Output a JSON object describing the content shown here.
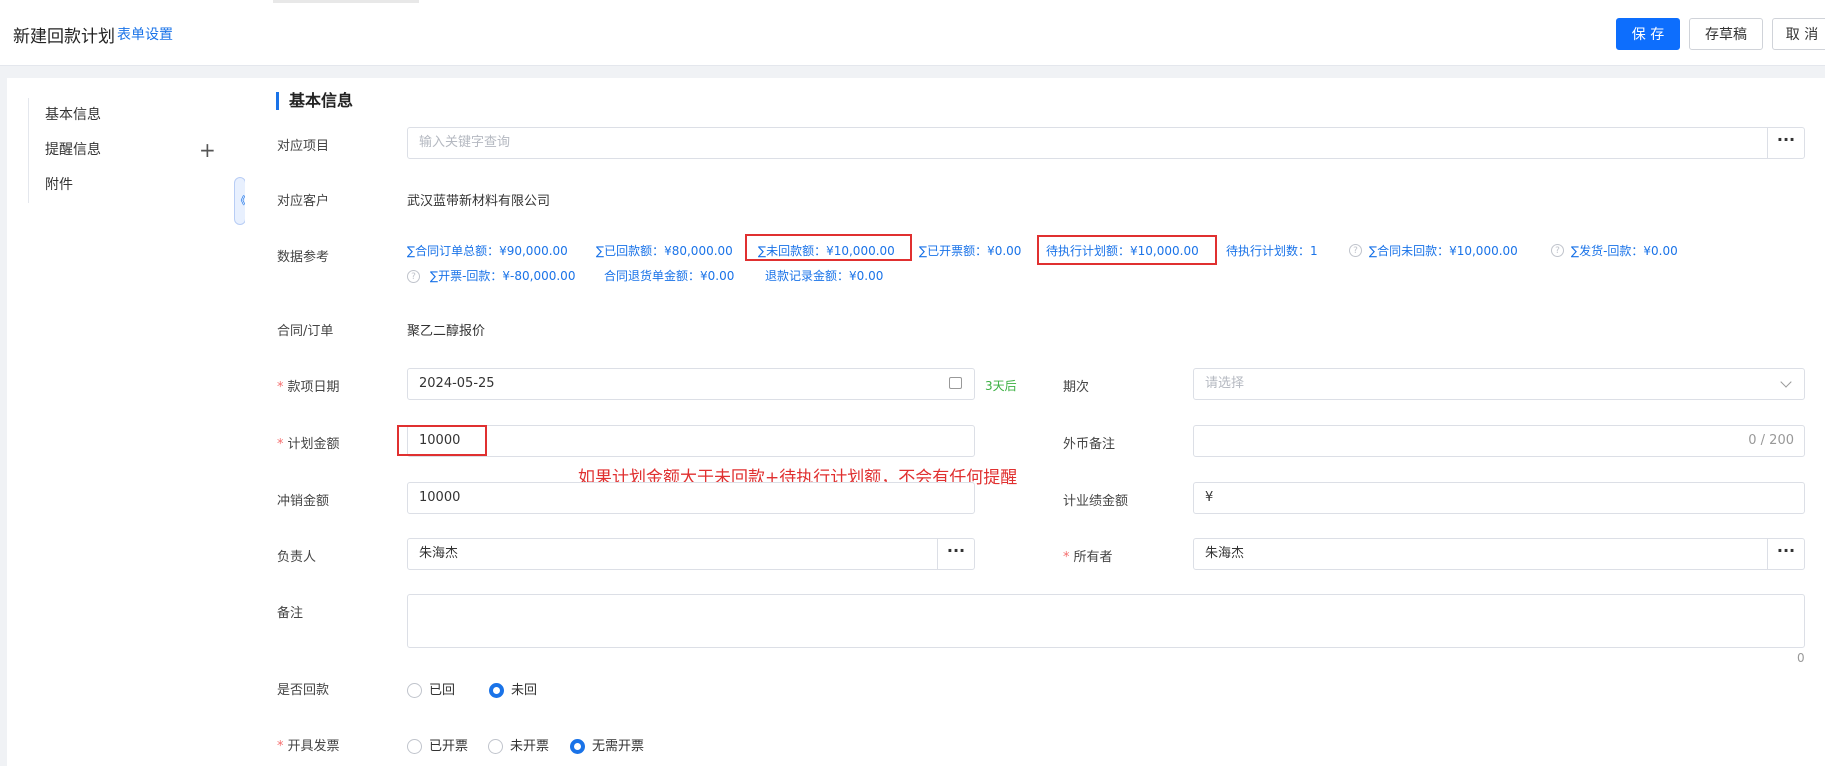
{
  "header": {
    "title": "新建回款计划",
    "form_settings": "表单设置",
    "save": "保 存",
    "draft": "存草稿",
    "cancel": "取 消"
  },
  "sidebar": {
    "items": [
      {
        "label": "基本信息"
      },
      {
        "label": "提醒信息",
        "plus": "+"
      },
      {
        "label": "附件"
      }
    ],
    "collapse_icon": "《"
  },
  "section": {
    "title": "基本信息"
  },
  "form": {
    "project": {
      "label": "对应项目",
      "placeholder": "输入关键字查询",
      "more": "···"
    },
    "customer": {
      "label": "对应客户",
      "value": "武汉蓝带新材料有限公司"
    },
    "reference": {
      "label": "数据参考",
      "row1": [
        "∑合同订单总额：¥90,000.00",
        "∑已回款额：¥80,000.00",
        "∑未回款额：¥10,000.00",
        "∑已开票额：¥0.00",
        "待执行计划额：¥10,000.00",
        "待执行计划数：1",
        "∑合同未回款：¥10,000.00",
        "∑发货-回款：¥0.00"
      ],
      "row2": [
        "∑开票-回款：¥-80,000.00",
        "合同退货单金额：¥0.00",
        "退款记录金额：¥0.00"
      ],
      "help": "?"
    },
    "contract": {
      "label": "合同/订单",
      "value": "聚乙二醇报价"
    },
    "date": {
      "label": "款项日期",
      "required": "*",
      "value": "2024-05-25",
      "hint": "3天后"
    },
    "period": {
      "label": "期次",
      "placeholder": "请选择"
    },
    "plan_amount": {
      "label": "计划金额",
      "required": "*",
      "value": "10000"
    },
    "fx_note": {
      "label": "外币备注",
      "counter": "0 / 200"
    },
    "offset_amount": {
      "label": "冲销金额",
      "value": "10000"
    },
    "perf_amount": {
      "label": "计业绩金额",
      "value": "¥"
    },
    "owner_person": {
      "label": "负责人",
      "value": "朱海杰"
    },
    "holder": {
      "label": "所有者",
      "required": "*",
      "value": "朱海杰"
    },
    "remark": {
      "label": "备注",
      "counter": "0"
    },
    "returned": {
      "label": "是否回款",
      "options": [
        "已回",
        "未回"
      ],
      "selected": "未回"
    },
    "invoice": {
      "label": "开具发票",
      "required": "*",
      "options": [
        "已开票",
        "未开票",
        "无需开票"
      ],
      "selected": "无需开票"
    }
  },
  "annotation": "如果计划金额大于未回款+待执行计划额，不会有任何提醒",
  "colors": {
    "accent": "#1a73e8",
    "primary_button": "#0d6efd",
    "annotation_red": "#e03030",
    "required": "#f56c6c",
    "hint_green": "#3cb043"
  }
}
